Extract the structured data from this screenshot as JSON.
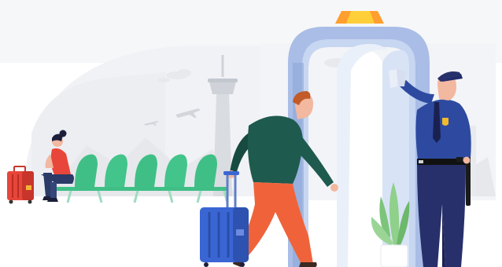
{
  "illustration": {
    "subject": "airport-security-checkpoint",
    "palette": {
      "background": "#ffffff",
      "sky_haze": "#eef0f3",
      "skyline_gray": "#e2e5ea",
      "tower_gray": "#cfd3d9",
      "seat_green": "#3fbf86",
      "seat_green_dark": "#2f9e6c",
      "gate_blue": "#9fb6e3",
      "gate_blue_dark": "#7a93c9",
      "gate_beacon_orange": "#ff9f2f",
      "gate_beacon_yellow": "#ffcf3a",
      "traveler_jacket": "#1f5a4e",
      "traveler_pants": "#f0633a",
      "suitcase_blue": "#3a66d4",
      "suitcase_red": "#e8463a",
      "officer_navy": "#27306b",
      "officer_shirt": "#2d4aa0",
      "badge_gold": "#f2b92c",
      "plant_green": "#7cc47a"
    },
    "icons": [
      "control-tower-icon",
      "airplane-icon",
      "metal-detector-gate-icon",
      "suitcase-icon",
      "security-officer-icon",
      "waiting-seats-icon",
      "potted-plant-icon",
      "passport-icon"
    ]
  }
}
